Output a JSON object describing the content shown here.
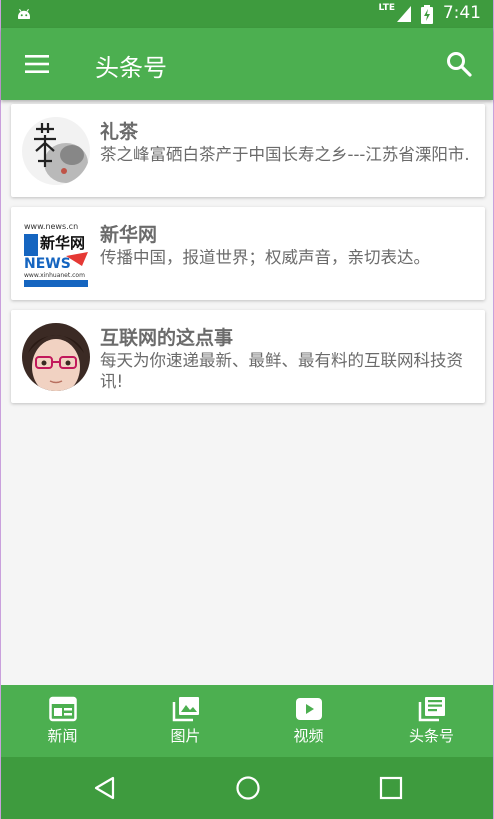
{
  "status_bar": {
    "network": "LTE",
    "time": "7:41"
  },
  "app_bar": {
    "title": "头条号"
  },
  "cards": [
    {
      "title": "礼茶",
      "desc": "茶之峰富硒白茶产于中国长寿之乡---江苏省溧阳市."
    },
    {
      "title": "新华网",
      "desc": "传播中国，报道世界；权威声音，亲切表达。",
      "logo_text": "新华网",
      "logo_sub": "NEWS",
      "logo_url_text": "www.news.cn",
      "logo_small_text": "www.xinhuanet.com"
    },
    {
      "title": "互联网的这点事",
      "desc": "每天为你速递最新、最鲜、最有料的互联网科技资讯!"
    }
  ],
  "bottom_nav": [
    {
      "label": "新闻",
      "icon": "news-icon"
    },
    {
      "label": "图片",
      "icon": "photo-library-icon"
    },
    {
      "label": "视频",
      "icon": "video-icon"
    },
    {
      "label": "头条号",
      "icon": "library-books-icon"
    }
  ],
  "colors": {
    "primary": "#4caf50",
    "primary_dark": "#3e9b3e",
    "text": "#6b6b6b"
  }
}
